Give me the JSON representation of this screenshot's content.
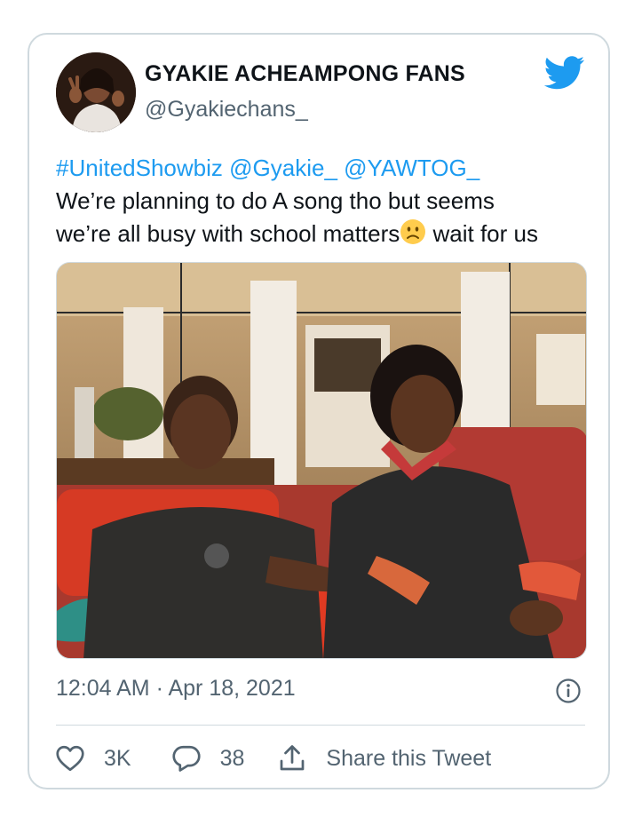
{
  "tweet": {
    "author": {
      "display_name": "GYAKIE ACHEAMPONG FANS",
      "handle": "@Gyakiechans_",
      "avatar_icon": "profile-photo"
    },
    "brand_icon": "twitter-bird-icon",
    "text": {
      "hashtag": "#UnitedShowbiz",
      "mention_1": "@Gyakie_",
      "mention_2": "@YAWTOG_",
      "body_line_1": "We’re planning to do A song tho but seems",
      "body_line_2_before_emoji": "we’re all busy with school matters",
      "emoji": "slightly-frowning-face",
      "body_line_2_after_emoji": " wait for us"
    },
    "timestamp": "12:04 AM · Apr 18, 2021",
    "actions": {
      "like_count": "3K",
      "reply_count": "38",
      "share_label": "Share this Tweet"
    }
  },
  "colors": {
    "link": "#1d9bf0",
    "secondary_text": "#536471",
    "border": "#cfd9de",
    "brand": "#1d9bf0"
  }
}
